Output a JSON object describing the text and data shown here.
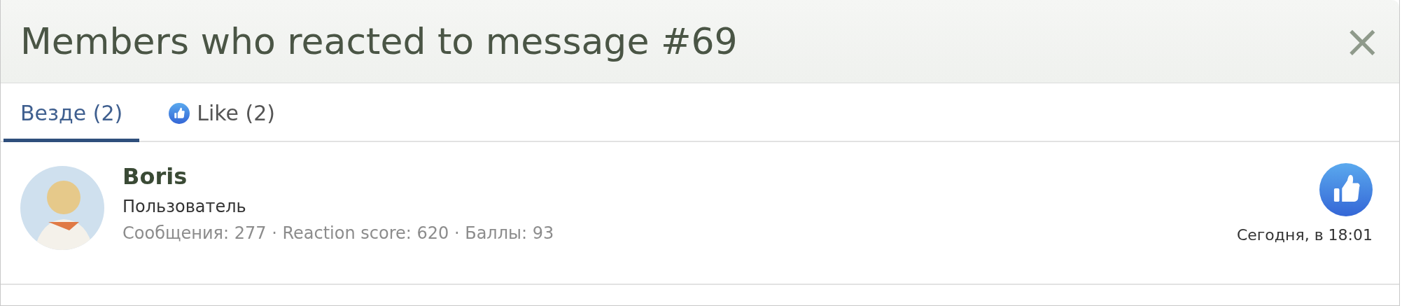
{
  "dialog": {
    "title": "Members who reacted to message #69",
    "close": "×"
  },
  "tabs": [
    {
      "label": "Везде (2)",
      "kind": "all",
      "selected": true
    },
    {
      "label": "Like (2)",
      "kind": "like",
      "selected": false
    }
  ],
  "members": [
    {
      "name": "Boris",
      "role": "Пользователь",
      "stats": "Сообщения: 277 · Reaction score: 620 · Баллы: 93",
      "time": "Сегодня, в 18:01"
    }
  ]
}
